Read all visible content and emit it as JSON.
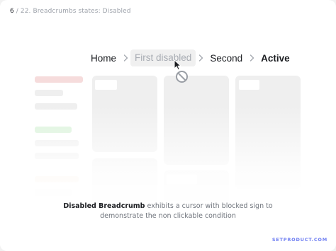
{
  "header": {
    "page_number": "6",
    "separator": "/",
    "section_title": "22. Breadcrumbs states: Disabled"
  },
  "breadcrumb": {
    "items": [
      {
        "label": "Home",
        "state": "default"
      },
      {
        "label": "First disabled",
        "state": "disabled"
      },
      {
        "label": "Second",
        "state": "default"
      },
      {
        "label": "Active",
        "state": "active"
      }
    ],
    "separator_icon": "chevron-right-icon"
  },
  "cursor": {
    "icon": "arrow-pointer-icon",
    "badge_icon": "blocked-sign-icon"
  },
  "caption": {
    "bold_part": "Disabled Breadcrumb",
    "rest_line1": " exhibits a cursor with blocked sign to",
    "line2": "demonstrate the non clickable condition"
  },
  "brand": {
    "label": "SETPRODUCT.COM",
    "color": "#6e7ef2"
  },
  "colors": {
    "disabled_bg": "#f0f0f0",
    "disabled_text": "#a8acb3",
    "text": "#1b1d21"
  }
}
